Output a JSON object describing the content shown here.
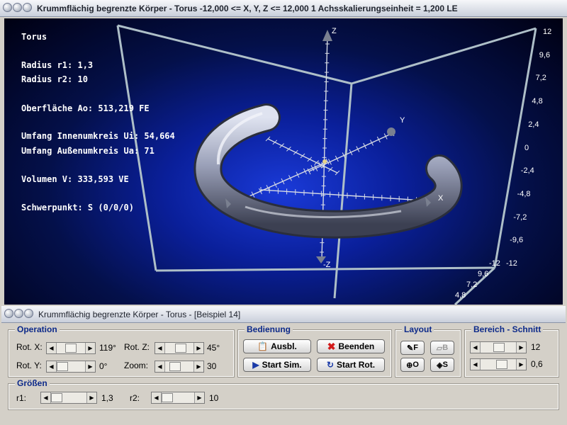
{
  "window_main": {
    "title": "Krummflächig begrenzte Körper - Torus   -12,000 <= X, Y, Z <= 12,000    1 Achsskalierungseinheit = 1,200 LE"
  },
  "info": {
    "name": "Torus",
    "r1": "Radius r1: 1,3",
    "r2": "Radius r2: 10",
    "surface": "Oberfläche Ao: 513,219 FE",
    "inner": "Umfang Innenumkreis Ui: 54,664",
    "outer": "Umfang Außenumkreis Ua: 71",
    "volume": "Volumen V: 333,593 VE",
    "centroid": "Schwerpunkt: S (0/0/0)"
  },
  "axes": {
    "z": "Z",
    "neg_z": "-Z",
    "y": "Y",
    "x": "X"
  },
  "scale_right": [
    "12",
    "9,6",
    "7,2",
    "4,8",
    "2,4",
    "0",
    "-2,4",
    "-4,8",
    "-7,2",
    "-9,6",
    "-12"
  ],
  "scale_bottom": [
    "-12",
    "9,6",
    "7,2",
    "4,8"
  ],
  "window_sub": {
    "title": "Krummflächig begrenzte Körper - Torus - [Beispiel 14]"
  },
  "operation": {
    "title": "Operation",
    "rotx_label": "Rot. X:",
    "rotx_value": "119°",
    "roty_label": "Rot. Y:",
    "roty_value": "0°",
    "rotz_label": "Rot. Z:",
    "rotz_value": "45°",
    "zoom_label": "Zoom:",
    "zoom_value": "30"
  },
  "bedienung": {
    "title": "Bedienung",
    "ausbl": "Ausbl.",
    "beenden": "Beenden",
    "start_sim": "Start Sim.",
    "start_rot": "Start Rot."
  },
  "layout": {
    "title": "Layout",
    "f": "F",
    "b": "B",
    "o": "O",
    "s": "S"
  },
  "bereich": {
    "title": "Bereich - Schnitt",
    "value1": "12",
    "value2": "0,6"
  },
  "groessen": {
    "title": "Größen",
    "r1_label": "r1:",
    "r1_value": "1,3",
    "r2_label": "r2:",
    "r2_value": "10"
  },
  "colors": {
    "accent": "#0d2a8a",
    "viewport_bg": "#0a1f9a",
    "torus": "#9aa0b8"
  },
  "icons": {
    "ausbl": "clipboard-icon",
    "beenden": "red-x-icon",
    "start_sim": "play-icon",
    "start_rot": "rotate-icon",
    "f": "pen-icon",
    "b": "eraser-icon",
    "o": "target-icon",
    "s": "paint-icon"
  }
}
